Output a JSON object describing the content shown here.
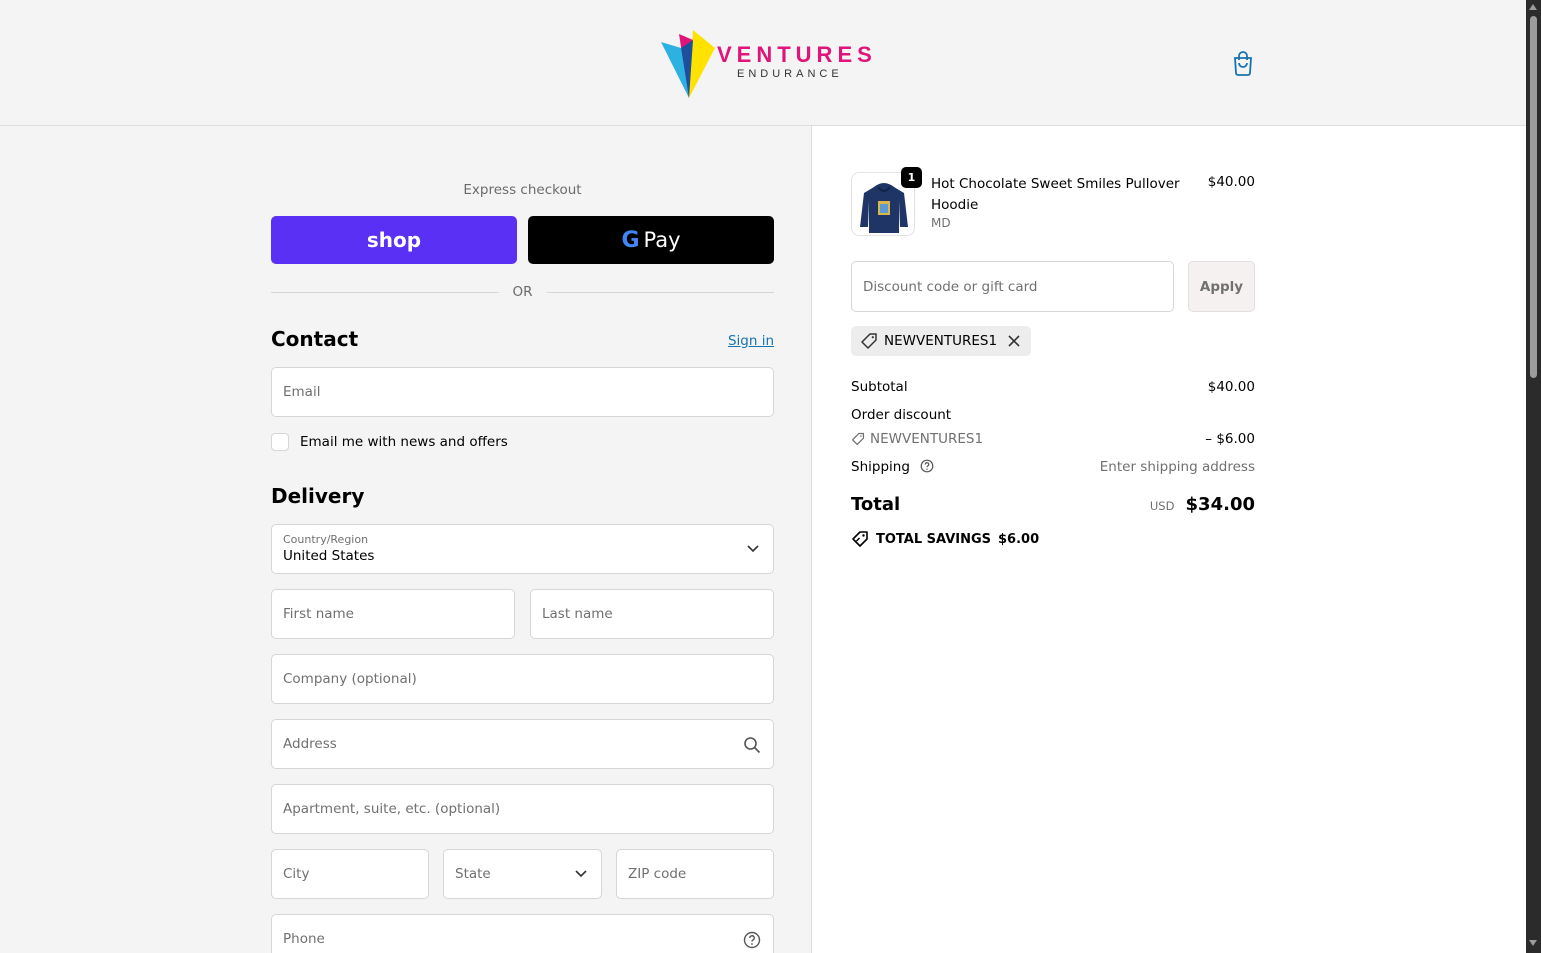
{
  "brand": {
    "logo_line1": "VENTURES",
    "logo_line2": "ENDURANCE",
    "colors": {
      "magenta": "#e0157a",
      "cyan": "#2cb1e1",
      "yellow": "#ffe200",
      "shop_purple": "#5a31f4",
      "link": "#1773b0"
    }
  },
  "header": {
    "cart_icon": "shopping-bag-icon"
  },
  "express": {
    "label": "Express checkout",
    "shop_label": "shop",
    "gpay_g": "G",
    "gpay_label": "Pay",
    "or_label": "OR"
  },
  "contact": {
    "title": "Contact",
    "signin_label": "Sign in",
    "email_placeholder": "Email",
    "newsletter_label": "Email me with news and offers"
  },
  "delivery": {
    "title": "Delivery",
    "country_label": "Country/Region",
    "country_value": "United States",
    "first_name_placeholder": "First name",
    "last_name_placeholder": "Last name",
    "company_placeholder": "Company (optional)",
    "address_placeholder": "Address",
    "apartment_placeholder": "Apartment, suite, etc. (optional)",
    "city_placeholder": "City",
    "state_label": "State",
    "zip_placeholder": "ZIP code",
    "phone_placeholder": "Phone"
  },
  "summary": {
    "item": {
      "name": "Hot Chocolate Sweet Smiles Pullover Hoodie",
      "variant": "MD",
      "price": "$40.00",
      "quantity": "1"
    },
    "discount_placeholder": "Discount code or gift card",
    "apply_label": "Apply",
    "applied_code": "NEWVENTURES1",
    "subtotal_label": "Subtotal",
    "subtotal_value": "$40.00",
    "order_discount_label": "Order discount",
    "order_discount_code": "NEWVENTURES1",
    "order_discount_value": "– $6.00",
    "shipping_label": "Shipping",
    "shipping_value": "Enter shipping address",
    "total_label": "Total",
    "total_currency": "USD",
    "total_value": "$34.00",
    "savings_label": "TOTAL SAVINGS",
    "savings_value": "$6.00"
  }
}
